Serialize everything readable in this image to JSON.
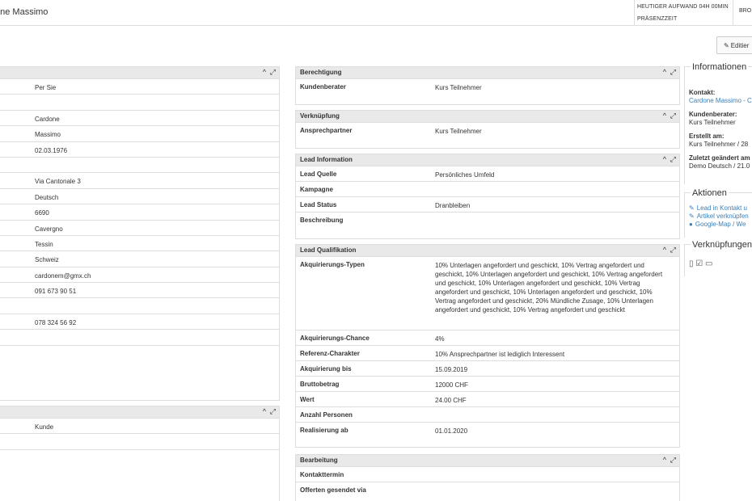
{
  "topbar": {
    "title": "one Massimo",
    "heutiger_aufwand": "HEUTIGER AUFWAND 04H 00MIN",
    "praesenzzeit": "PRÄSENZZEIT",
    "bro": "BRO"
  },
  "edit_button": {
    "label": "Editier"
  },
  "left_panel": {
    "values": [
      "Per Sie",
      "",
      "Cardone",
      "Massimo",
      "02.03.1976",
      "",
      "Via Cantonale 3",
      "Deutsch",
      "6690",
      "Cavergno",
      "Tessin",
      "Schweiz",
      "cardonem@gmx.ch",
      "091 673 90 51",
      "",
      "078 324 56 92",
      "",
      ""
    ]
  },
  "left_panel2": {
    "values": [
      "Kunde",
      "",
      ""
    ]
  },
  "berechtigung": {
    "title": "Berechtigung",
    "rows": [
      {
        "key": "Kundenberater",
        "value": "Kurs Teilnehmer"
      }
    ]
  },
  "verknuepfung": {
    "title": "Verknüpfung",
    "rows": [
      {
        "key": "Ansprechpartner",
        "value": "Kurs Teilnehmer"
      }
    ]
  },
  "lead_information": {
    "title": "Lead Information",
    "rows": [
      {
        "key": "Lead Quelle",
        "value": "Persönliches Umfeld"
      },
      {
        "key": "Kampagne",
        "value": ""
      },
      {
        "key": "Lead Status",
        "value": "Dranbleiben"
      },
      {
        "key": "Beschreibung",
        "value": ""
      }
    ]
  },
  "lead_qualifikation": {
    "title": "Lead Qualifikation",
    "rows": [
      {
        "key": "Akquirierungs-Typen",
        "value": "10% Unterlagen angefordert und geschickt, 10% Vertrag angefordert und geschickt, 10% Unterlagen angefordert und geschickt, 10% Vertrag angefordert und geschickt, 10% Unterlagen angefordert und geschickt, 10% Vertrag angefordert und geschickt, 10% Unterlagen angefordert und geschickt, 10% Vertrag angefordert und geschickt, 20% Mündliche Zusage, 10% Unterlagen angefordert und geschickt, 10% Vertrag angefordert und geschickt"
      },
      {
        "key": "Akquirierungs-Chance",
        "value": "4%"
      },
      {
        "key": "Referenz-Charakter",
        "value": "10% Ansprechpartner ist lediglich Interessent"
      },
      {
        "key": "Akquirierung bis",
        "value": "15.09.2019"
      },
      {
        "key": "Bruttobetrag",
        "value": "12000 CHF"
      },
      {
        "key": "Wert",
        "value": "24.00 CHF"
      },
      {
        "key": "Anzahl Personen",
        "value": ""
      },
      {
        "key": "Realisierung ab",
        "value": "01.01.2020"
      }
    ]
  },
  "bearbeitung": {
    "title": "Bearbeitung",
    "rows": [
      {
        "key": "Kontakttermin",
        "value": ""
      },
      {
        "key": "Offerten gesendet via",
        "value": ""
      }
    ]
  },
  "sidebar": {
    "informationen_title": "Informationen",
    "kontakt_label": "Kontakt:",
    "kontakt_value": "Cardone Massimo - C",
    "kundenberater_label": "Kundenberater:",
    "kundenberater_value": "Kurs Teilnehmer",
    "erstellt_label": "Erstellt am:",
    "erstellt_value": "Kurs Teilnehmer / 28",
    "geaendert_label": "Zuletzt geändert am",
    "geaendert_value": "Demo Deutsch / 21.0",
    "aktionen_title": "Aktionen",
    "aktionen": [
      "Lead in Kontakt u",
      "Artikel verknüpfen",
      "Google-Map / We"
    ],
    "verknuepfungen_title": "Verknüpfungen"
  },
  "icons": {
    "collapse": "chevron-up-icon",
    "expand": "expand-icon",
    "edit": "pencil-icon"
  },
  "colors": {
    "header_bg": "#e9e9e9",
    "border": "#dddddd",
    "link": "#3a7fb7"
  }
}
